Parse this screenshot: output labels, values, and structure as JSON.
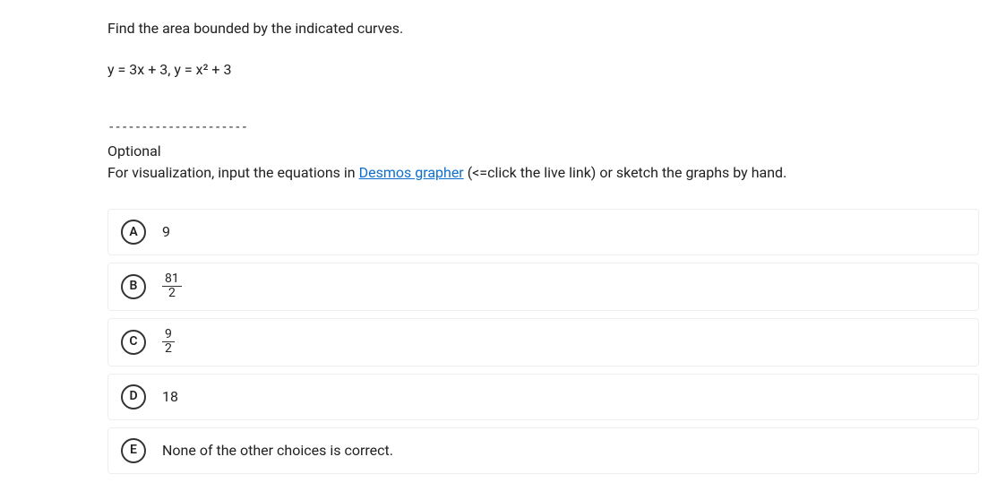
{
  "question": {
    "prompt": "Find the area bounded by the indicated curves.",
    "equation": "y = 3x + 3, y = x² + 3",
    "divider": "---------------------",
    "optional_label": "Optional",
    "visualization_prefix": "For visualization, input the equations in ",
    "visualization_link": "Desmos grapher",
    "visualization_suffix": " (<=click the live link) or sketch the graphs by hand."
  },
  "choices": [
    {
      "letter": "A",
      "type": "text",
      "value": "9"
    },
    {
      "letter": "B",
      "type": "fraction",
      "num": "81",
      "den": "2"
    },
    {
      "letter": "C",
      "type": "fraction",
      "num": "9",
      "den": "2"
    },
    {
      "letter": "D",
      "type": "text",
      "value": "18"
    },
    {
      "letter": "E",
      "type": "text",
      "value": "None of the other choices is correct."
    }
  ]
}
